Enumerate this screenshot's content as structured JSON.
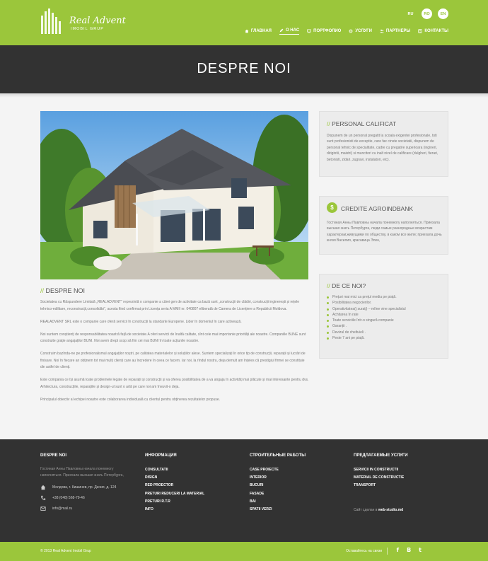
{
  "header": {
    "logo_name": "Real Advent",
    "logo_sub": "IMOBIL GRUP",
    "languages": [
      "RU",
      "RO",
      "EN"
    ],
    "nav": [
      {
        "label": "ГЛАВНАЯ",
        "icon": "home-icon"
      },
      {
        "label": "О НАС",
        "icon": "pencil-icon",
        "active": true
      },
      {
        "label": "ПОРТФОЛИО",
        "icon": "monitor-icon"
      },
      {
        "label": "УСЛУГИ",
        "icon": "gear-icon"
      },
      {
        "label": "ПАРТНЕРЫ",
        "icon": "users-icon"
      },
      {
        "label": "КОНТАКТЫ",
        "icon": "contact-icon"
      }
    ]
  },
  "banner": {
    "title": "DESPRE NOI"
  },
  "about": {
    "title": "DESPRE NOI",
    "paragraphs": [
      "Societatea cu Răspundere Limitată „REALADVENT” reprezintă o companie a cărei gen de activitate ca bază sunt „construcții de clădiri, construcții inginerești și rețele tehnico-edilitare, reconstrucții,consolidări”, acesta fiind confirmat prin Licența seria A MMII  nr. 040807  eliberată de Camera de Licențiere a Republicii Moldova.",
      "REALADVENT  SRL  este o companie care oferă servicii în construcții la standarte Europene. Lider  în domeniul în care activează.",
      "Noi suntem conștienți de responsabilitatea noastră față de societate.A oferi  servicii de înaltă calitate, sînt cele mai importante priorități ale noastre. Companiile BUNE sunt construite grație angajaților BUNI. Noi avem drept scop să fim cei  mai  BUNI  în toate acțiunile noastre.",
      "Construim bazînda-ne pe profesionalismul angajaților noștri, pe calitatea materialelor și soluțiilor alese. Suntem specializați în orice tip de construcții, reparații și lucrări de finisare. Noi în fiecare an obținem tot mai mulți clienți care au încredere în ceea ce facem. Iar noi, la rîndul nostru, deja demult am înțeles că prestigiul firmei se constituie din astfel de clienți.",
      "Este compania ce își asumă toate problemele legate de reparații și construcții și va oferea posibilitatea de a va angaja în activități mai plăcute și mai interesante pentru dvs. Arhitectura, construcțiile, reparațiile și design-ul sunt o artă pe care noi am învuvit-o deja.",
      "Principalul obiectiv al echipei noastre este colaborarea individuală cu clientul pentru obținerea rezultatelor propuse."
    ]
  },
  "sidebar": {
    "personal": {
      "title": "PERSONAL CALIFICAT",
      "text": "Dispunem de un personal pregatit la scoala exigentei profesionale, toti sunt profesionisti de exceptie, care fac cinste societatii, dispunem de personal tehnic de specialitate, cadre cu pregatire superioara (ingineri, dirigintii, maistri) si muncitori cu inalt nivel de calificare (dulgheri, fierari, betonisti, zidari, zugravi, instalatori, etc)."
    },
    "credit": {
      "title": "CREDITE AGROINDBANK",
      "icon_text": "$",
      "text": "Гостиная Анны Павловны начала понемногу наполняться. Приехала высшая знать Петербурга, люди самые разнородные возрастам характерам,живущими по обществу, в каком все жили; приехала дочь князя Василия, красавица Элен,"
    },
    "reasons": {
      "title": "DE CE NOI?",
      "items": [
        "Prețuri mai mici ca prețul mediu pe piață.",
        "Posibilitatea negocierilor.",
        "Operativitatea(ț surați) – mîine vine specialistul",
        "Achitarea în rate",
        "Toate serviciile într-o singură companie",
        "Garanții .",
        "Devizul de cheltuieli .",
        "Peste 7 ani pe piață."
      ]
    }
  },
  "footer": {
    "col1": {
      "title": "DESPRE NOI",
      "text": "Гостиная Анны Павловны начала понемногу наполняться. Приехала высшая знать Петербурга,",
      "address": "Молдова, г. Кишинев, пр. Дачия, д. 124",
      "phone": "+38 (048) 568-79-46",
      "email": "info@mail.ru"
    },
    "col2": {
      "title": "ИНФОРМАЦИЯ",
      "links": [
        "CONSULTATII",
        "DISIGN",
        "RED PROECTOR",
        "PRETURI REDUCERI LA MATERIAL",
        "PRETURI R.T.R",
        "INFO"
      ]
    },
    "col3": {
      "title": "СТРОИТЕЛЬНЫЕ РАБОТЫ",
      "links": [
        "CASE PROIECTE",
        "INTERIOR",
        "BUCURI",
        "FASADE",
        "BAI",
        "SPATII VERZI"
      ]
    },
    "col4": {
      "title": "ПРЕДЛАГАЕМЫЕ УСЛУГИ",
      "links": [
        "SERVICII IN CONSTRUCTII",
        "MATERIAL DE CONSTRUCTIE",
        "TRANSPORT"
      ]
    },
    "credit_prefix": "Сайт сделан в ",
    "credit_studio": "web-studio.md"
  },
  "bottom": {
    "copyright": "© 2013 Real Advent Imobil Grup",
    "social_label": "Оставайтесь на связи",
    "social": [
      "f",
      "B",
      "t"
    ]
  },
  "colors": {
    "accent": "#9bc63b",
    "dark": "#323232",
    "light": "#f4f4f4"
  }
}
